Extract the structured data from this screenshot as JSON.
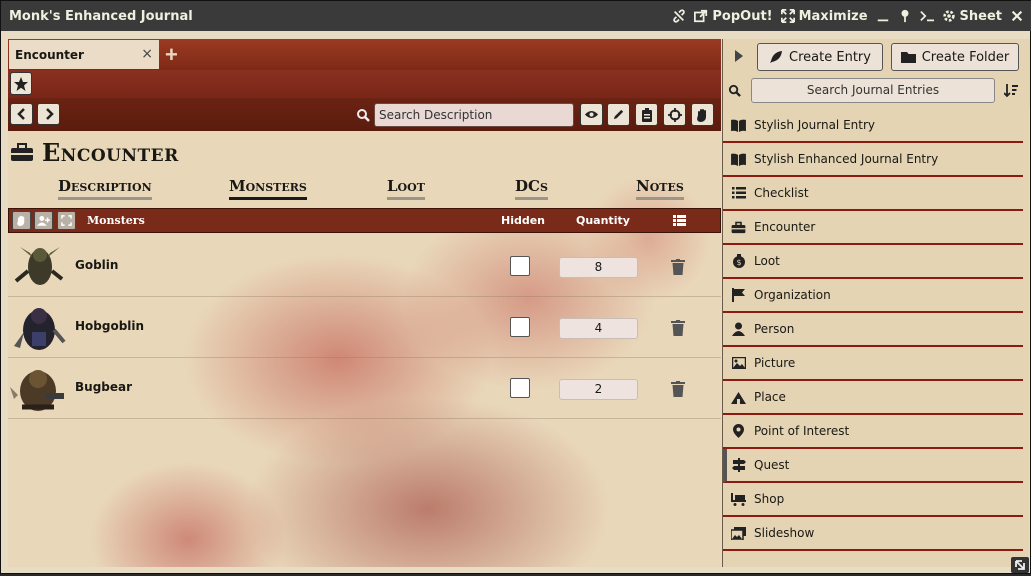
{
  "window": {
    "title": "Monk's Enhanced Journal",
    "header_buttons": [
      "PopOut!",
      "Maximize",
      "Sheet"
    ]
  },
  "tabs": [
    {
      "label": "Encounter",
      "close": "×"
    }
  ],
  "add_tab_label": "+",
  "search": {
    "placeholder": "Search Description"
  },
  "page": {
    "title": "Encounter"
  },
  "subtabs": [
    {
      "label": "Description",
      "active": false
    },
    {
      "label": "Monsters",
      "active": true
    },
    {
      "label": "Loot",
      "active": false
    },
    {
      "label": "DCs",
      "active": false
    },
    {
      "label": "Notes",
      "active": false
    }
  ],
  "monsters_table": {
    "headers": {
      "name": "Monsters",
      "hidden": "Hidden",
      "quantity": "Quantity"
    },
    "rows": [
      {
        "name": "Goblin",
        "hidden": false,
        "quantity": "8"
      },
      {
        "name": "Hobgoblin",
        "hidden": false,
        "quantity": "4"
      },
      {
        "name": "Bugbear",
        "hidden": false,
        "quantity": "2"
      }
    ]
  },
  "sidebar": {
    "create_entry": "Create Entry",
    "create_folder": "Create Folder",
    "search_placeholder": "Search Journal Entries",
    "entries": [
      {
        "label": "Stylish Journal Entry",
        "icon": "book-open-icon"
      },
      {
        "label": "Stylish Enhanced Journal Entry",
        "icon": "book-open-icon"
      },
      {
        "label": "Checklist",
        "icon": "list-icon"
      },
      {
        "label": "Encounter",
        "icon": "toolbox-icon"
      },
      {
        "label": "Loot",
        "icon": "money-bag-icon"
      },
      {
        "label": "Organization",
        "icon": "flag-icon"
      },
      {
        "label": "Person",
        "icon": "user-icon"
      },
      {
        "label": "Picture",
        "icon": "image-icon"
      },
      {
        "label": "Place",
        "icon": "place-icon"
      },
      {
        "label": "Point of Interest",
        "icon": "map-pin-icon"
      },
      {
        "label": "Quest",
        "icon": "signpost-icon"
      },
      {
        "label": "Shop",
        "icon": "cart-icon"
      },
      {
        "label": "Slideshow",
        "icon": "images-icon"
      }
    ]
  },
  "colors": {
    "accent": "#7a2a18",
    "parchment": "#e9d7ba",
    "border_red": "#8b1a10"
  }
}
